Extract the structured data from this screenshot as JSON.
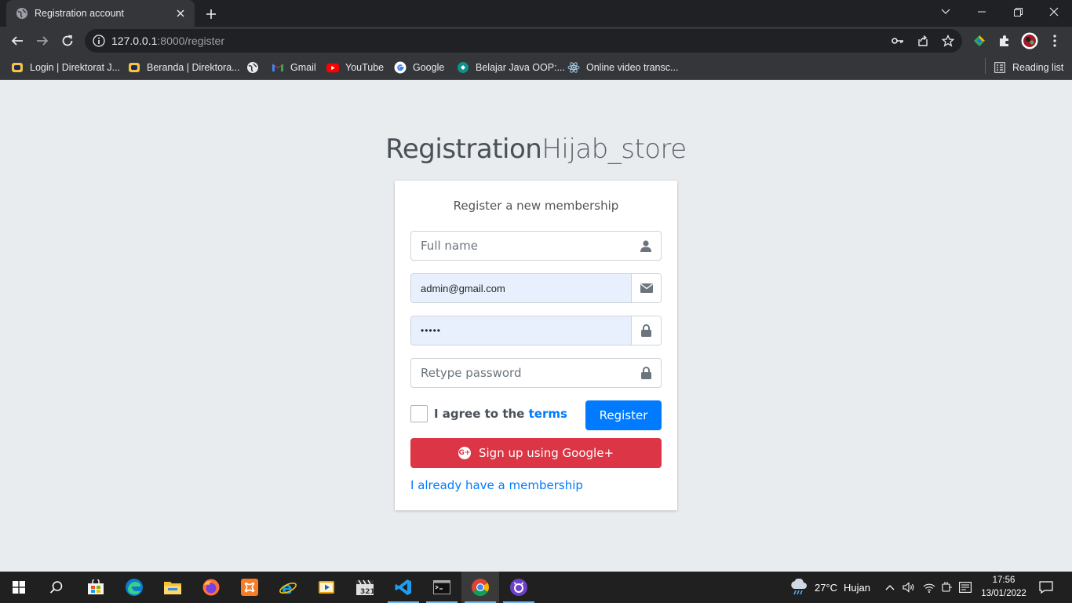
{
  "browser": {
    "tab": {
      "title": "Registration account"
    },
    "address": {
      "host": "127.0.0.1",
      "rest": ":8000/register"
    },
    "bookmarks": [
      {
        "label": "Login | Direktorat J...",
        "icon": "direktorat-icon"
      },
      {
        "label": "Beranda | Direktora...",
        "icon": "direktorat-icon"
      },
      {
        "label": "",
        "icon": "globe-icon"
      },
      {
        "label": "Gmail",
        "icon": "gmail-icon"
      },
      {
        "label": "YouTube",
        "icon": "youtube-icon"
      },
      {
        "label": "Google",
        "icon": "google-icon"
      },
      {
        "label": "Belajar Java OOP:...",
        "icon": "codepolitan-icon"
      },
      {
        "label": "Online video transc...",
        "icon": "react-icon"
      }
    ],
    "reading_list": "Reading list"
  },
  "page": {
    "brand_bold": "Registration",
    "brand_light": "Hijab_store",
    "box_msg": "Register a new membership",
    "fields": {
      "fullname_placeholder": "Full name",
      "email_value": "admin@gmail.com",
      "password_value": "•••••",
      "retype_placeholder": "Retype password"
    },
    "agree_text": "I agree to the",
    "terms_link": "terms",
    "register_label": "Register",
    "google_label": "Sign up using Google+",
    "google_icon_text": "G+",
    "member_link": "I already have a membership"
  },
  "taskbar": {
    "weather_temp": "27°C",
    "weather_desc": "Hujan",
    "time": "17:56",
    "date": "13/01/2022"
  },
  "colors": {
    "primary": "#007bff",
    "danger": "#dc3545",
    "page_bg": "#e9ecef",
    "autofill_bg": "#e8f0fe"
  }
}
